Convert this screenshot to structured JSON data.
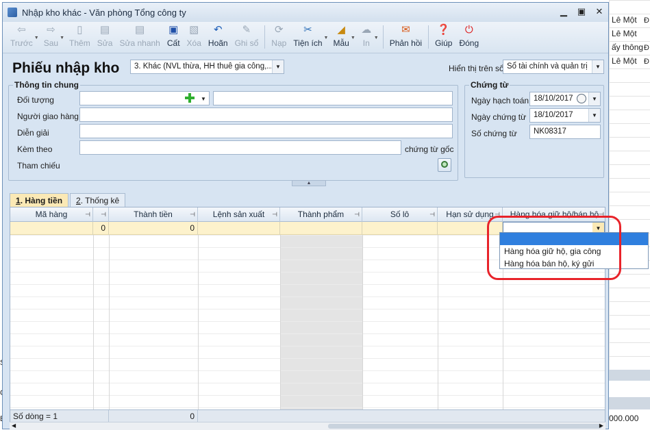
{
  "window": {
    "title": "Nhập kho khác - Văn phòng Tổng công ty"
  },
  "background": {
    "rows": [
      "Lê Một",
      "Lê Một",
      "ấy thông",
      "Lê Một"
    ],
    "edge": [
      "Đ",
      "Đ",
      "Đ"
    ],
    "footer_value": "000.000",
    "left_labels": [
      "Số",
      "C",
      "BI"
    ]
  },
  "toolbar": {
    "prev": "Trước",
    "next": "Sau",
    "add": "Thêm",
    "edit": "Sửa",
    "quick_edit": "Sửa nhanh",
    "save": "Cất",
    "delete": "Xóa",
    "undo": "Hoãn",
    "post": "Ghi sổ",
    "load": "Nạp",
    "utilities": "Tiện ích",
    "template": "Mẫu",
    "print": "In",
    "feedback": "Phản hồi",
    "help": "Giúp",
    "close": "Đóng"
  },
  "header": {
    "title": "Phiếu nhập kho",
    "type_select": "3. Khác (NVL thừa, HH thuê gia công,...",
    "display_label": "Hiển thị trên sổ",
    "display_select": "Sổ tài chính và quản trị"
  },
  "general": {
    "title": "Thông tin chung",
    "object_label": "Đối tượng",
    "deliverer_label": "Người giao hàng",
    "description_label": "Diễn giải",
    "attach_label": "Kèm theo",
    "attach_suffix": "chứng từ gốc",
    "reference_label": "Tham chiếu"
  },
  "voucher": {
    "title": "Chứng từ",
    "posting_date_label": "Ngày hạch toán",
    "posting_date": "18/10/2017",
    "voucher_date_label": "Ngày chứng từ",
    "voucher_date": "18/10/2017",
    "voucher_no_label": "Số chứng từ",
    "voucher_no": "NK08317"
  },
  "tabs": [
    {
      "key": "1",
      "label": ". Hàng tiền"
    },
    {
      "key": "2",
      "label": ". Thống kê"
    }
  ],
  "grid": {
    "columns": [
      "Mã hàng",
      "",
      "Thành tiền",
      "Lệnh sản xuất",
      "Thành phẩm",
      "Số lô",
      "Hạn sử dụng",
      "Hàng hóa giữ hộ/bán hộ"
    ],
    "row": {
      "qty": "0",
      "amount": "0"
    },
    "footer": {
      "count": "Số dòng = 1",
      "amount_total": "0"
    }
  },
  "dropdown": {
    "options": [
      "",
      "Hàng hóa giữ hộ, gia công",
      "Hàng hóa bán hộ, ký gửi"
    ]
  },
  "colors": {
    "accent": "#2f7fde",
    "highlight": "#e8232a",
    "edit_row": "#fdf2cc"
  }
}
